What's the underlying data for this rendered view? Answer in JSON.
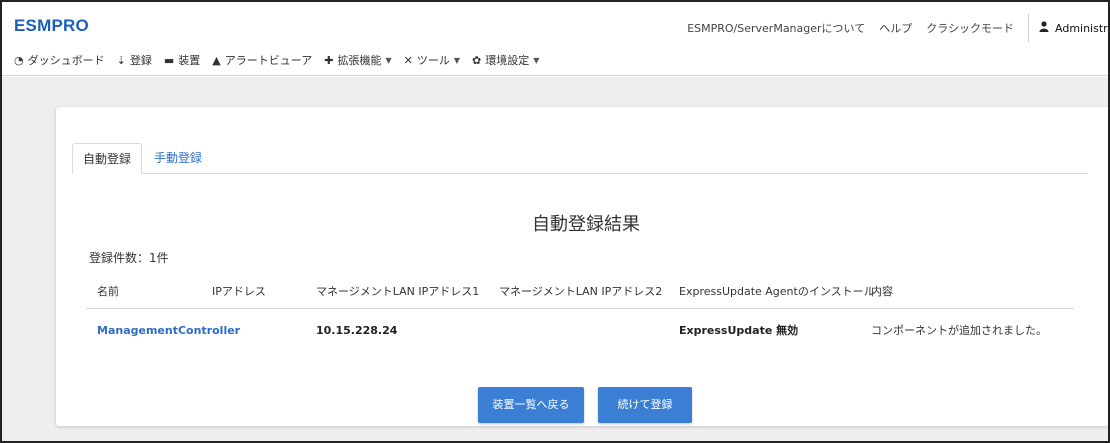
{
  "header": {
    "brand": "ESMPRO",
    "links": [
      "ESMPRO/ServerManagerについて",
      "ヘルプ",
      "クラシックモード"
    ],
    "user": "Administrato"
  },
  "menu": [
    {
      "label": "ダッシュボード",
      "icon": "dashboard-icon",
      "glyph": "◔",
      "dropdown": false
    },
    {
      "label": "登録",
      "icon": "register-icon",
      "glyph": "⇣",
      "dropdown": false
    },
    {
      "label": "装置",
      "icon": "device-icon",
      "glyph": "▬",
      "dropdown": false
    },
    {
      "label": "アラートビューア",
      "icon": "alert-icon",
      "glyph": "▲",
      "dropdown": false
    },
    {
      "label": "拡張機能",
      "icon": "plus-icon",
      "glyph": "✚",
      "dropdown": true
    },
    {
      "label": "ツール",
      "icon": "tools-icon",
      "glyph": "✕",
      "dropdown": true
    },
    {
      "label": "環境設定",
      "icon": "gear-icon",
      "glyph": "✿",
      "dropdown": true
    }
  ],
  "tabs": {
    "auto": "自動登録",
    "manual": "手動登録"
  },
  "result": {
    "title": "自動登録結果",
    "count": "登録件数：1件",
    "columns": [
      "名前",
      "IPアドレス",
      "マネージメントLAN IPアドレス1",
      "マネージメントLAN IPアドレス2",
      "ExpressUpdate Agentのインストール",
      "内容"
    ],
    "rows": [
      {
        "name": "ManagementController",
        "ip": "",
        "mgmt_ip1": "10.15.228.24",
        "mgmt_ip2": "",
        "agent": "ExpressUpdate 無効",
        "content": "コンポーネントが追加されました。"
      }
    ]
  },
  "buttons": {
    "back": "装置一覧へ戻る",
    "continue": "続けて登録"
  },
  "colors": {
    "accent": "#1b5fbd",
    "link": "#2f6cc4",
    "button": "#3b7fd4",
    "background": "#eeeeee"
  }
}
